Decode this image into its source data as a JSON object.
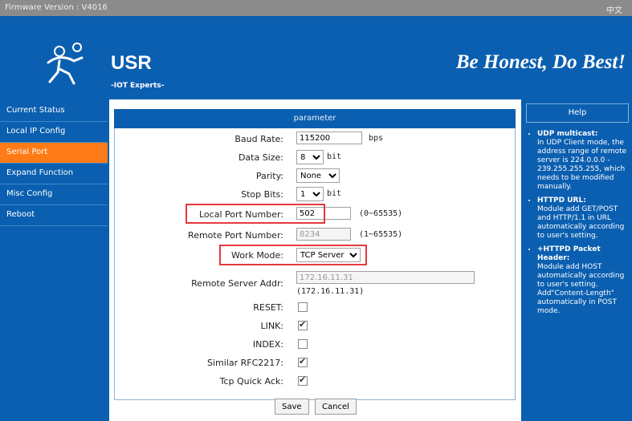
{
  "topbar": {
    "firmware_text": "Firmware Version : V4016",
    "lang": "中文"
  },
  "header": {
    "brand": "USR",
    "subtitle": "-IOT Experts-",
    "slogan": "Be Honest, Do Best!"
  },
  "nav": {
    "items": [
      "Current Status",
      "Local IP Config",
      "Serial Port",
      "Expand Function",
      "Misc Config",
      "Reboot"
    ],
    "active_index": 2
  },
  "form": {
    "title": "parameter",
    "baud_rate": {
      "label": "Baud Rate:",
      "value": "115200",
      "unit": "bps"
    },
    "data_size": {
      "label": "Data Size:",
      "value": "8",
      "unit": "bit"
    },
    "parity": {
      "label": "Parity:",
      "value": "None"
    },
    "stop_bits": {
      "label": "Stop Bits:",
      "value": "1",
      "unit": "bit"
    },
    "local_port": {
      "label": "Local Port Number:",
      "value": "502",
      "range": "(0~65535)"
    },
    "remote_port": {
      "label": "Remote Port Number:",
      "value": "8234",
      "range": "(1~65535)"
    },
    "work_mode": {
      "label": "Work Mode:",
      "value": "TCP Server"
    },
    "remote_server": {
      "label": "Remote Server Addr:",
      "value": "172.16.11.31",
      "display": "(172.16.11.31)"
    },
    "reset": {
      "label": "RESET:",
      "checked": false
    },
    "link": {
      "label": "LINK:",
      "checked": true
    },
    "index": {
      "label": "INDEX:",
      "checked": false
    },
    "rfc2217": {
      "label": "Similar RFC2217:",
      "checked": true
    },
    "tcp_quick_ack": {
      "label": "Tcp Quick Ack:",
      "checked": true
    },
    "save_label": "Save",
    "cancel_label": "Cancel"
  },
  "help": {
    "title": "Help",
    "items": [
      {
        "heading": "UDP multicast:",
        "text": "In UDP Client mode, the address range of remote server is 224.0.0.0 - 239.255.255.255, which needs to be modified manually."
      },
      {
        "heading": "HTTPD URL:",
        "text": "Module add GET/POST and HTTP/1.1 in URL automatically according to user's setting."
      },
      {
        "heading": "+HTTPD Packet Header:",
        "text": "Module add HOST automatically according to user's setting. Add\"Content-Length\" automatically in POST mode."
      }
    ]
  },
  "colors": {
    "primary": "#0b5fb0",
    "active": "#ff7b17",
    "highlight": "#e5393c",
    "topbar": "#8b8b8b"
  }
}
